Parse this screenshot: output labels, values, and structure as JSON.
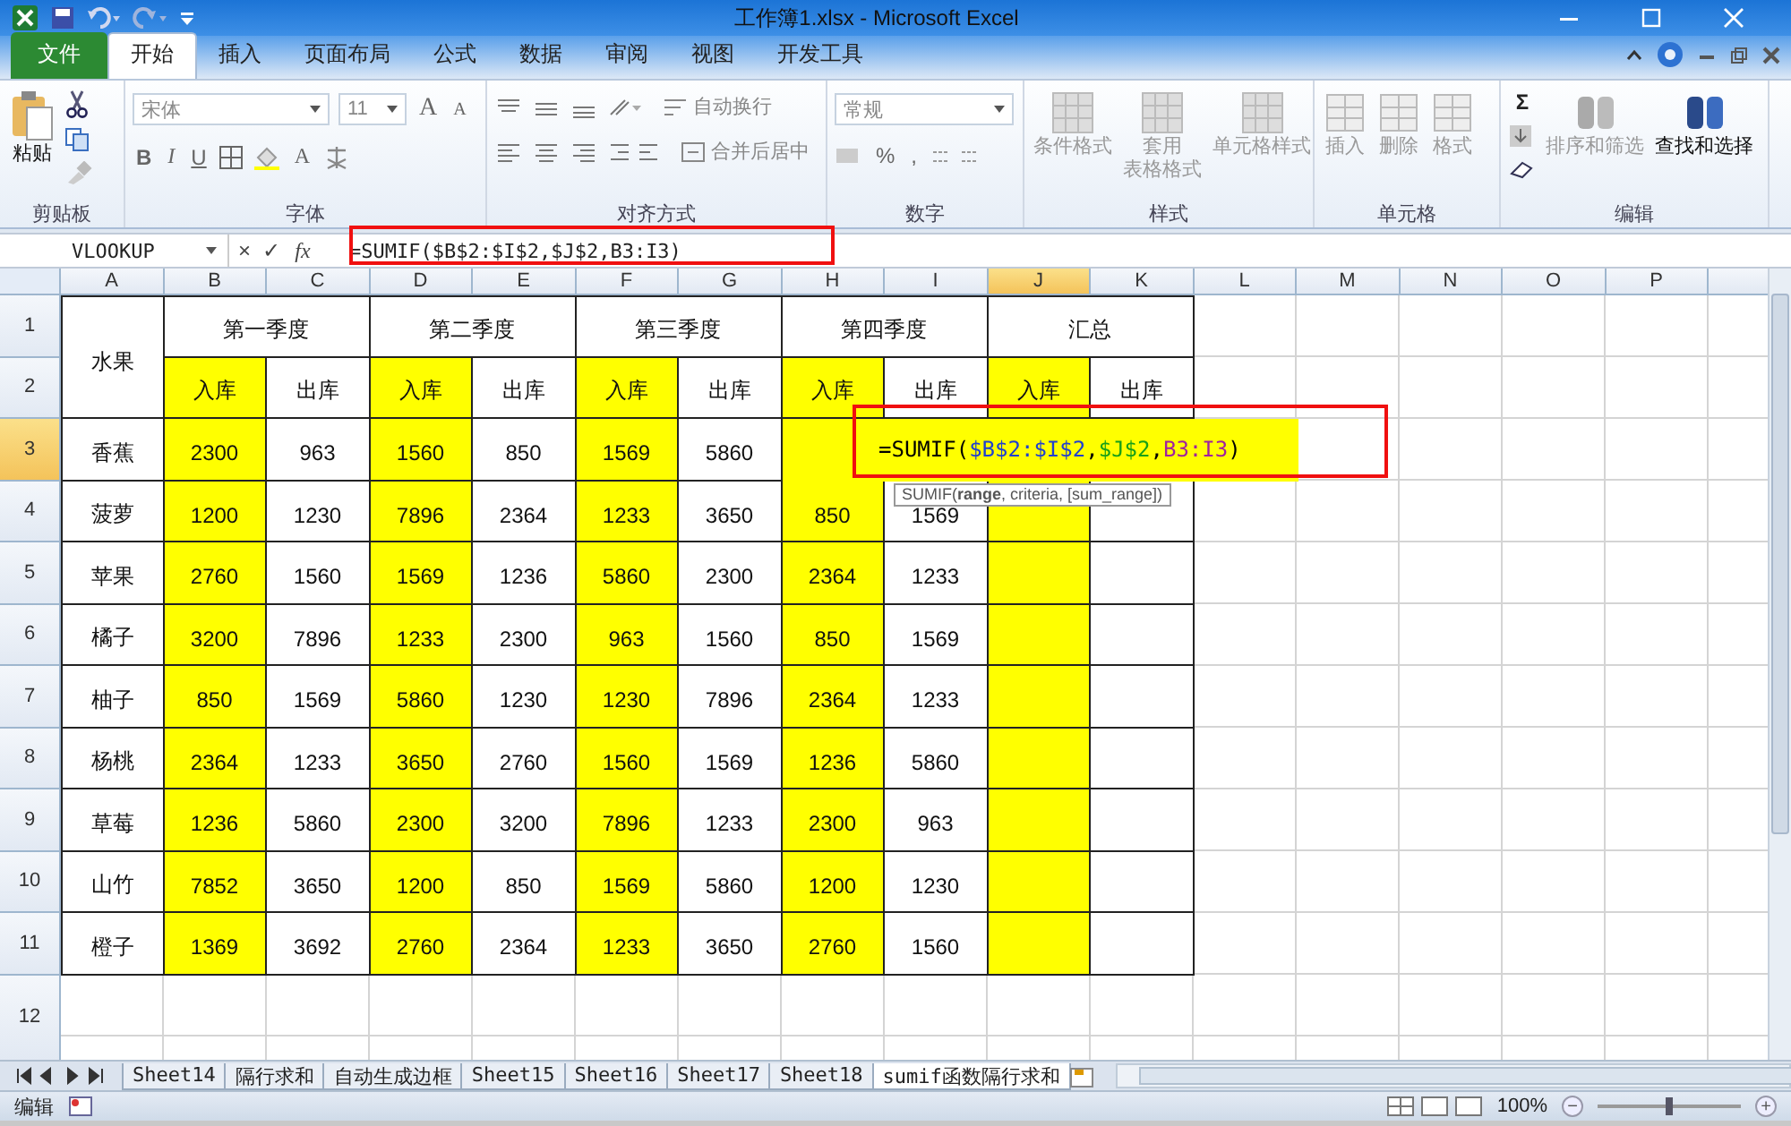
{
  "window": {
    "title": "工作簿1.xlsx - Microsoft Excel"
  },
  "menu_tabs": [
    {
      "label": "文件",
      "kind": "file",
      "selected": false
    },
    {
      "label": "开始",
      "kind": "tab",
      "selected": true
    },
    {
      "label": "插入",
      "kind": "tab",
      "selected": false
    },
    {
      "label": "页面布局",
      "kind": "tab",
      "selected": false
    },
    {
      "label": "公式",
      "kind": "tab",
      "selected": false
    },
    {
      "label": "数据",
      "kind": "tab",
      "selected": false
    },
    {
      "label": "审阅",
      "kind": "tab",
      "selected": false
    },
    {
      "label": "视图",
      "kind": "tab",
      "selected": false
    },
    {
      "label": "开发工具",
      "kind": "tab",
      "selected": false
    }
  ],
  "ribbon": {
    "clipboard": {
      "paste": "粘贴",
      "label": "剪贴板"
    },
    "font": {
      "name": "宋体",
      "size": "11",
      "grow": "A",
      "shrink": "A",
      "styles": [
        "B",
        "I",
        "U"
      ],
      "font_color": "A",
      "label": "字体"
    },
    "alignment": {
      "wrap": "自动换行",
      "merge": "合并后居中",
      "label": "对齐方式"
    },
    "number": {
      "format": "常规",
      "percent": "%",
      "comma": ",",
      "label": "数字"
    },
    "styles": {
      "buttons": [
        [
          "条件格式"
        ],
        [
          "套用",
          "表格格式"
        ],
        [
          "单元格样式"
        ]
      ],
      "label": "样式"
    },
    "cells": {
      "buttons": [
        "插入",
        "删除",
        "格式"
      ],
      "label": "单元格"
    },
    "editing": {
      "sum": "Σ",
      "buttons": [
        {
          "label": "排序和筛选",
          "disabled": true
        },
        {
          "label": "查找和选择",
          "disabled": false
        }
      ],
      "label": "编辑"
    }
  },
  "formula_bar": {
    "name_box": "VLOOKUP",
    "cancel": "×",
    "enter": "✓",
    "fx": "fx",
    "formula": "=SUMIF($B$2:$I$2,$J$2,B3:I3)"
  },
  "sheet": {
    "columns": [
      {
        "label": "A",
        "selected": false
      },
      {
        "label": "B",
        "selected": false
      },
      {
        "label": "C",
        "selected": false
      },
      {
        "label": "D",
        "selected": false
      },
      {
        "label": "E",
        "selected": false
      },
      {
        "label": "F",
        "selected": false
      },
      {
        "label": "G",
        "selected": false
      },
      {
        "label": "H",
        "selected": false
      },
      {
        "label": "I",
        "selected": false
      },
      {
        "label": "J",
        "selected": true
      },
      {
        "label": "K",
        "selected": false
      },
      {
        "label": "L",
        "selected": false
      },
      {
        "label": "M",
        "selected": false
      },
      {
        "label": "N",
        "selected": false
      },
      {
        "label": "O",
        "selected": false
      },
      {
        "label": "P",
        "selected": false
      }
    ],
    "rows": [
      {
        "label": "1",
        "selected": false
      },
      {
        "label": "2",
        "selected": false
      },
      {
        "label": "3",
        "selected": true
      },
      {
        "label": "4",
        "selected": false
      },
      {
        "label": "5",
        "selected": false
      },
      {
        "label": "6",
        "selected": false
      },
      {
        "label": "7",
        "selected": false
      },
      {
        "label": "8",
        "selected": false
      },
      {
        "label": "9",
        "selected": false
      },
      {
        "label": "10",
        "selected": false
      },
      {
        "label": "11",
        "selected": false
      },
      {
        "label": "12",
        "selected": false
      }
    ],
    "table": {
      "title_cell": "水果",
      "quarters": [
        {
          "label": "第一季度",
          "cols": [
            {
              "label": "入库",
              "highlighted": true
            },
            {
              "label": "出库",
              "highlighted": false
            }
          ]
        },
        {
          "label": "第二季度",
          "cols": [
            {
              "label": "入库",
              "highlighted": true
            },
            {
              "label": "出库",
              "highlighted": false
            }
          ]
        },
        {
          "label": "第三季度",
          "cols": [
            {
              "label": "入库",
              "highlighted": true
            },
            {
              "label": "出库",
              "highlighted": false
            }
          ]
        },
        {
          "label": "第四季度",
          "cols": [
            {
              "label": "入库",
              "highlighted": true
            },
            {
              "label": "出库",
              "highlighted": false
            }
          ]
        },
        {
          "label": "汇总",
          "cols": [
            {
              "label": "入库",
              "highlighted": true
            },
            {
              "label": "出库",
              "highlighted": false
            }
          ]
        }
      ],
      "rows": [
        {
          "fruit": "香蕉",
          "values": [
            "2300",
            "963",
            "1560",
            "850",
            "1569",
            "5860"
          ]
        },
        {
          "fruit": "菠萝",
          "values": [
            "1200",
            "1230",
            "7896",
            "2364",
            "1233",
            "3650",
            "850",
            "1569"
          ]
        },
        {
          "fruit": "苹果",
          "values": [
            "2760",
            "1560",
            "1569",
            "1236",
            "5860",
            "2300",
            "2364",
            "1233"
          ]
        },
        {
          "fruit": "橘子",
          "values": [
            "3200",
            "7896",
            "1233",
            "2300",
            "963",
            "1560",
            "850",
            "1569"
          ]
        },
        {
          "fruit": "柚子",
          "values": [
            "850",
            "1569",
            "5860",
            "1230",
            "1230",
            "7896",
            "2364",
            "1233"
          ]
        },
        {
          "fruit": "杨桃",
          "values": [
            "2364",
            "1233",
            "3650",
            "2760",
            "1560",
            "1569",
            "1236",
            "5860"
          ]
        },
        {
          "fruit": "草莓",
          "values": [
            "1236",
            "5860",
            "2300",
            "3200",
            "7896",
            "1233",
            "2300",
            "963"
          ]
        },
        {
          "fruit": "山竹",
          "values": [
            "7852",
            "3650",
            "1200",
            "850",
            "1569",
            "5860",
            "1200",
            "1230"
          ]
        },
        {
          "fruit": "橙子",
          "values": [
            "1369",
            "3692",
            "2760",
            "2364",
            "1233",
            "3650",
            "2760",
            "1560"
          ]
        }
      ]
    },
    "editor": {
      "segments": [
        {
          "text": "=SUMIF(",
          "color": "#000000"
        },
        {
          "text": "$B$2:$I$2",
          "color": "#2040d0"
        },
        {
          "text": ",",
          "color": "#000000"
        },
        {
          "text": "$J$2",
          "color": "#18a018"
        },
        {
          "text": ",",
          "color": "#000000"
        },
        {
          "text": "B3:I3",
          "color": "#a020a0"
        },
        {
          "text": ")",
          "color": "#000000"
        }
      ]
    },
    "tooltip": "SUMIF(**range**, criteria, [sum_range])"
  },
  "sheet_tabs": [
    {
      "label": "Sheet14",
      "selected": false
    },
    {
      "label": "隔行求和",
      "selected": false
    },
    {
      "label": "自动生成边框",
      "selected": false
    },
    {
      "label": "Sheet15",
      "selected": false
    },
    {
      "label": "Sheet16",
      "selected": false
    },
    {
      "label": "Sheet17",
      "selected": false
    },
    {
      "label": "Sheet18",
      "selected": false
    },
    {
      "label": "sumif函数隔行求和",
      "selected": true
    }
  ],
  "status_bar": {
    "mode": "编辑",
    "zoom": "100%",
    "zoom_out": "−",
    "zoom_in": "+",
    "zoom_slider": {
      "level": 0.5
    }
  }
}
